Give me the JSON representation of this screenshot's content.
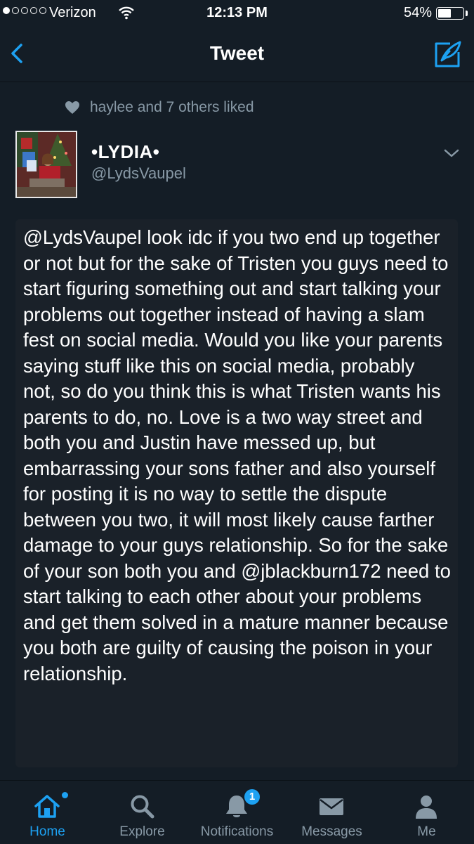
{
  "status_bar": {
    "carrier": "Verizon",
    "time": "12:13 PM",
    "battery_percent": "54%",
    "battery_level": 0.54,
    "signal_bars": 1
  },
  "nav": {
    "title": "Tweet",
    "back_icon": "chevron-left-icon",
    "compose_icon": "compose-icon"
  },
  "liked": {
    "text": "haylee and 7 others liked",
    "icon": "heart-icon"
  },
  "tweet": {
    "display_name": "•LYDIA•",
    "handle": "@LydsVaupel",
    "text": "@LydsVaupel look idc if you two end up together or not but for the sake of Tristen you guys need to start figuring something out and start talking your problems out together instead of having a slam fest on social media. Would you like your parents saying stuff like this on social media, probably not, so do you think this is what Tristen wants his parents to do, no. Love is a two way street and both you and Justin have messed up, but embarrassing your sons father and also yourself for posting it is no way to settle the dispute between you two, it will most likely cause farther damage to your guys relationship. So for the sake of your son both you and @jblackburn172  need to start talking to each other about your problems and get them solved in a mature manner because you both are guilty of causing the poison in your relationship."
  },
  "tabs": [
    {
      "label": "Home",
      "icon": "home-icon",
      "active": true
    },
    {
      "label": "Explore",
      "icon": "search-icon"
    },
    {
      "label": "Notifications",
      "icon": "bell-icon",
      "badge": "1"
    },
    {
      "label": "Messages",
      "icon": "envelope-icon"
    },
    {
      "label": "Me",
      "icon": "person-icon"
    }
  ],
  "colors": {
    "background": "#141d26",
    "accent": "#1da1f2",
    "muted": "#8899a6",
    "tweet_card": "#1a2129"
  }
}
